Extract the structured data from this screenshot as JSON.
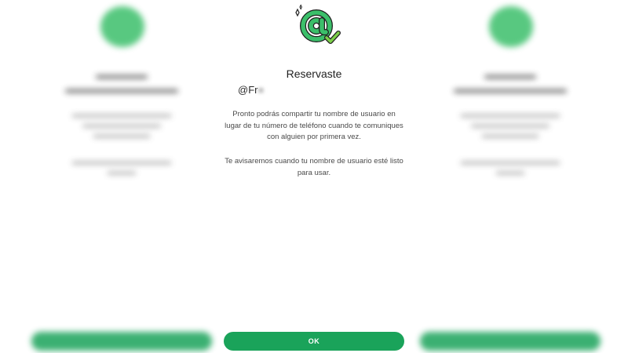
{
  "dialog": {
    "title": "Reservaste",
    "username_prefix": "@Fr",
    "username_hidden": "■",
    "paragraph1": "Pronto podrás compartir tu nombre de usuario en lugar de tu número de teléfono cuando te comuniques con alguien por primera vez.",
    "paragraph2": "Te avisaremos cuando tu nombre de usuario esté listo para usar.",
    "ok_label": "OK",
    "icon": "at-sign-check-icon"
  },
  "colors": {
    "accent": "#1aa35a",
    "icon_green": "#3bbf6a",
    "check_green": "#7ccf4a"
  }
}
